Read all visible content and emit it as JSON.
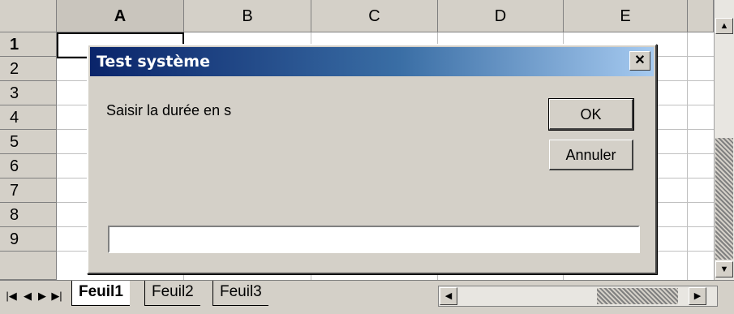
{
  "spreadsheet": {
    "columns": [
      "A",
      "B",
      "C",
      "D",
      "E"
    ],
    "rows": [
      "1",
      "2",
      "3",
      "4",
      "5",
      "6",
      "7",
      "8",
      "9"
    ],
    "selected_column": "A",
    "selected_row": "1"
  },
  "sheet_tabs": [
    "Feuil1",
    "Feuil2",
    "Feuil3"
  ],
  "active_tab": "Feuil1",
  "nav_glyphs": {
    "first": "|◀",
    "prev": "◀",
    "next": "▶",
    "last": "▶|"
  },
  "scroll_glyphs": {
    "up": "▲",
    "down": "▼",
    "left": "◀",
    "right": "▶"
  },
  "dialog": {
    "title": "Test système",
    "close_glyph": "✕",
    "prompt": "Saisir la durée en s",
    "ok_label": "OK",
    "cancel_label": "Annuler",
    "input_value": ""
  },
  "colors": {
    "title_start": "#0a246a",
    "title_end": "#a6caf0",
    "face": "#d4d0c8"
  },
  "icons": [
    "close-icon",
    "scroll-up-icon",
    "scroll-down-icon",
    "scroll-left-icon",
    "scroll-right-icon"
  ]
}
